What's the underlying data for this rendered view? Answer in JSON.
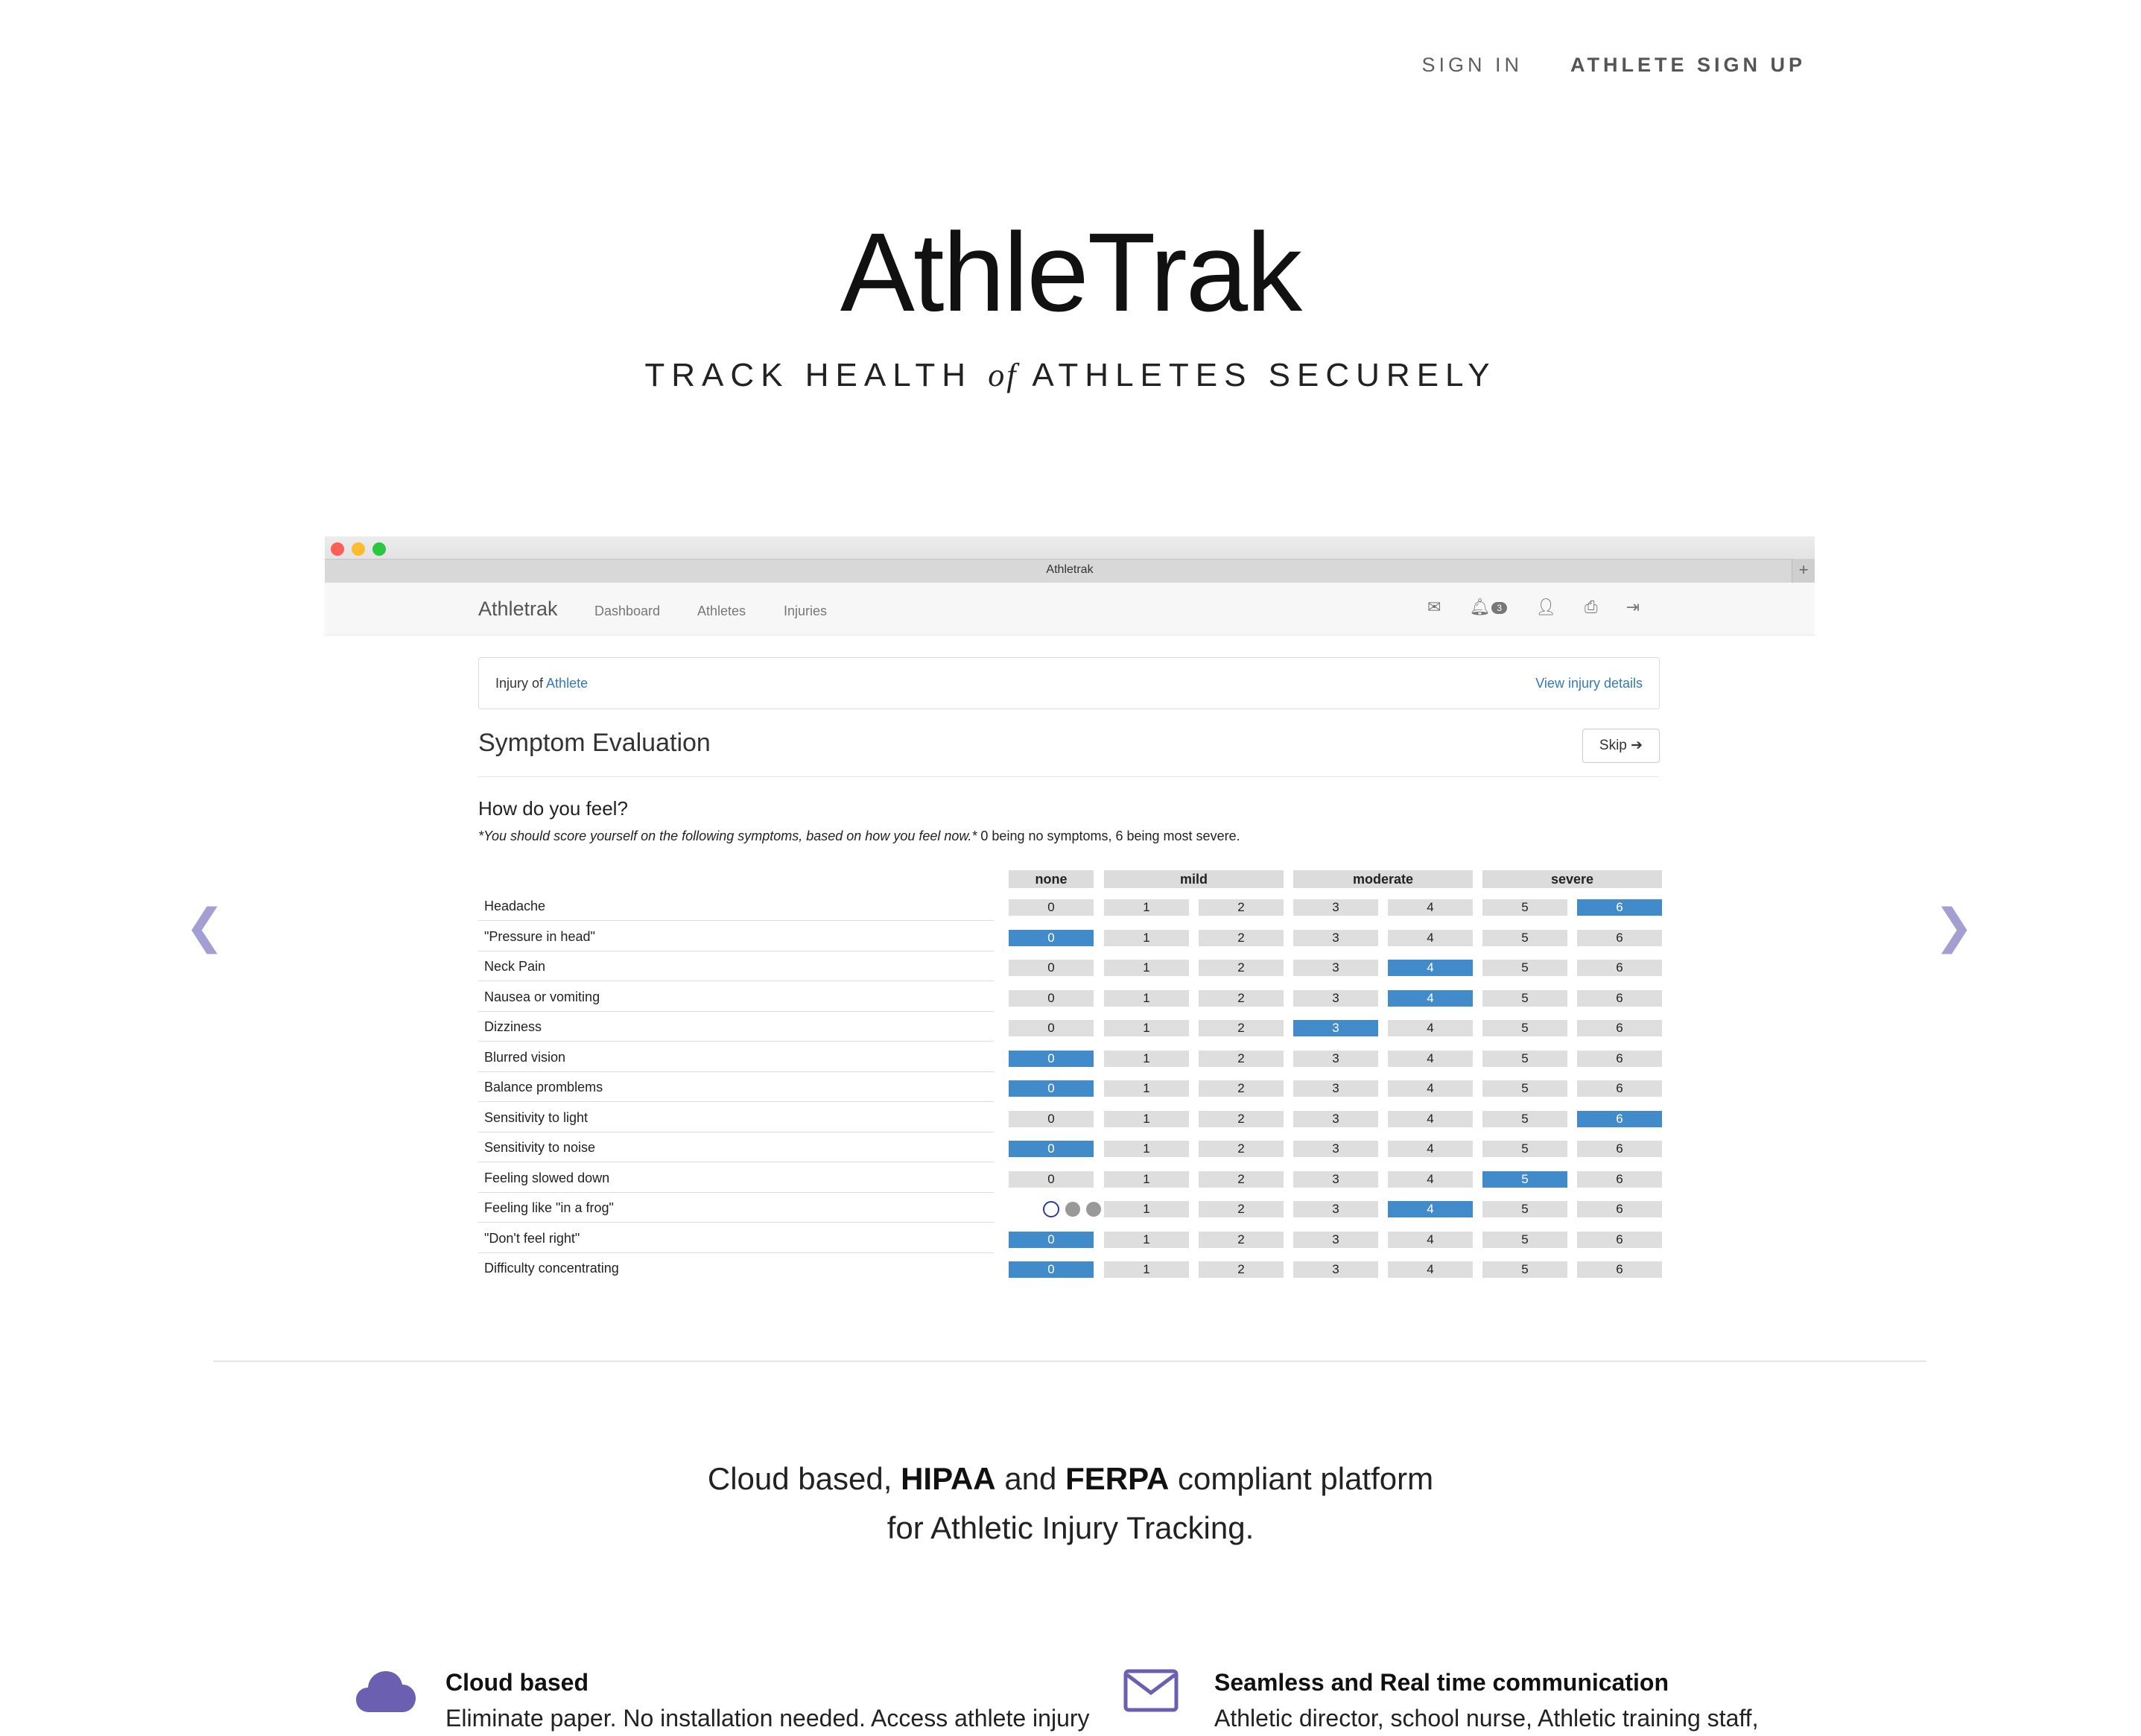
{
  "top_nav": {
    "sign_in": "SIGN IN",
    "athlete_sign_up": "ATHLETE SIGN UP"
  },
  "hero": {
    "title": "AthleTrak",
    "subtitle_pre": "TRACK HEALTH",
    "subtitle_of": "of",
    "subtitle_post": "ATHLETES SECURELY"
  },
  "carousel": {
    "prev_icon": "chevron-left-icon",
    "next_icon": "chevron-right-icon"
  },
  "window": {
    "tab_title": "Athletrak",
    "tab_plus": "+",
    "app_nav": {
      "brand": "Athletrak",
      "links": [
        "Dashboard",
        "Athletes",
        "Injuries"
      ],
      "icons": [
        "envelope-icon",
        "bell-icon",
        "user-icon",
        "print-icon",
        "sign-out-icon"
      ],
      "notification_count": "3"
    },
    "injury_panel": {
      "prefix": "Injury of",
      "athlete_link": "Athlete",
      "details_link": "View injury details"
    },
    "evaluation": {
      "title": "Symptom Evaluation",
      "skip_label": "Skip ➔",
      "question": "How do you feel?",
      "note_italic": "*You should score yourself on the following symptoms, based on how you feel now.*",
      "note_plain": " 0 being no symptoms, 6 being most severe.",
      "groups": [
        "none",
        "mild",
        "moderate",
        "severe"
      ],
      "scale": [
        "0",
        "1",
        "2",
        "3",
        "4",
        "5",
        "6"
      ],
      "symptoms": [
        {
          "label": "Headache",
          "selected": 6
        },
        {
          "label": "\"Pressure in head\"",
          "selected": 0
        },
        {
          "label": "Neck Pain",
          "selected": 4
        },
        {
          "label": "Nausea or vomiting",
          "selected": 4
        },
        {
          "label": "Dizziness",
          "selected": 3
        },
        {
          "label": "Blurred vision",
          "selected": 0
        },
        {
          "label": "Balance promblems",
          "selected": 0
        },
        {
          "label": "Sensitivity to light",
          "selected": 6
        },
        {
          "label": "Sensitivity to noise",
          "selected": 0
        },
        {
          "label": "Feeling slowed down",
          "selected": 5
        },
        {
          "label": "Feeling like \"in a frog\"",
          "selected": 4,
          "loading": true
        },
        {
          "label": "\"Don't feel right\"",
          "selected": 0
        },
        {
          "label": "Difficulty concentrating",
          "selected": 0
        }
      ]
    }
  },
  "pitch": {
    "line1_pre": "Cloud based,",
    "hipaa": "HIPAA",
    "and": "and",
    "ferpa": "FERPA",
    "line1_post": "compliant platform",
    "line2": "for Athletic Injury Tracking."
  },
  "features": [
    {
      "icon": "cloud-icon",
      "title": "Cloud based",
      "text": "Eliminate paper. No installation needed. Access athlete injury"
    },
    {
      "icon": "envelope-icon",
      "title": "Seamless and Real time communication",
      "text": "Athletic director, school nurse, Athletic training staff,"
    }
  ],
  "colors": {
    "accent": "#6a5fb0",
    "selected": "#428bca",
    "arrow": "#a49fd2"
  }
}
